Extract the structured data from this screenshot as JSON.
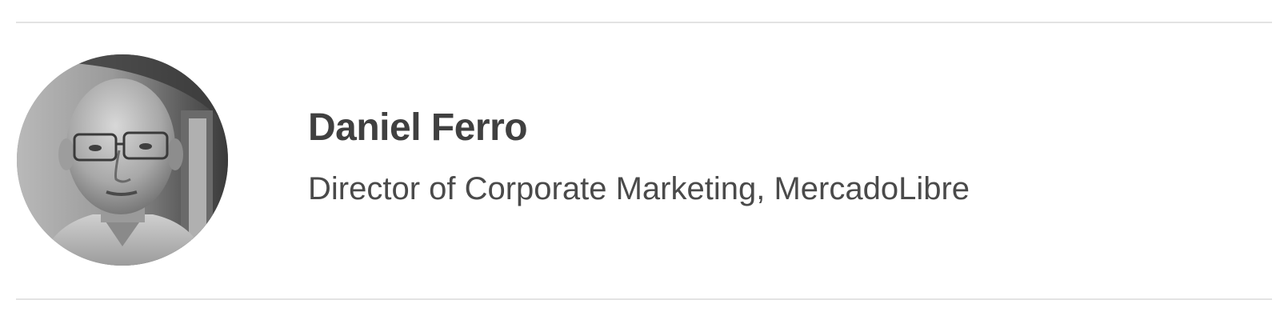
{
  "profile": {
    "name": "Daniel Ferro",
    "title": "Director of Corporate Marketing, MercadoLibre"
  },
  "avatar": {
    "icon": "person-photo"
  }
}
